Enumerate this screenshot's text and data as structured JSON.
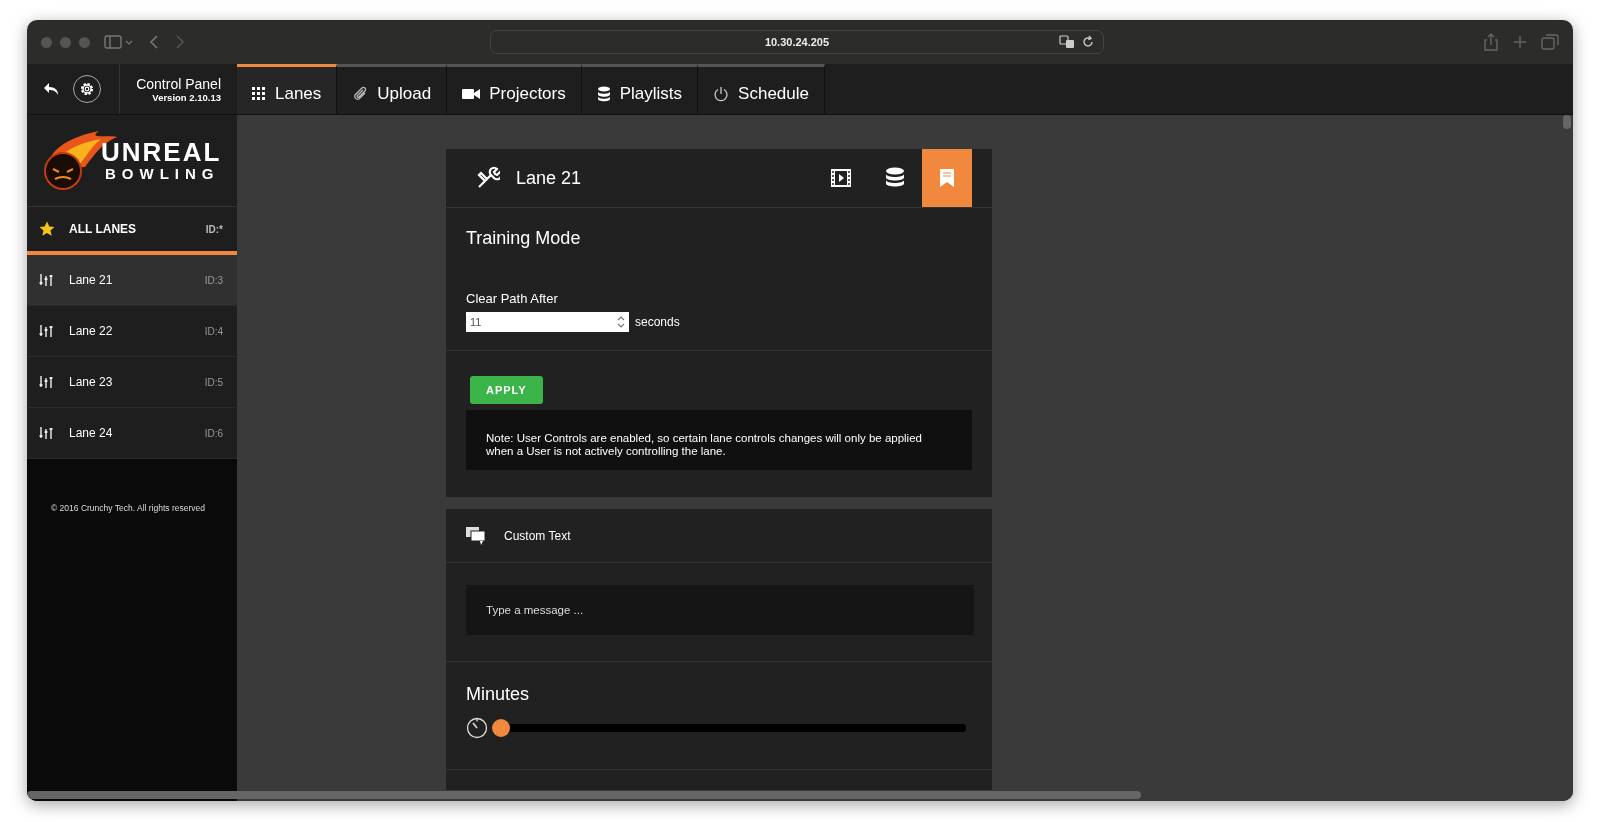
{
  "browser": {
    "url": "10.30.24.205"
  },
  "header": {
    "title": "Control Panel",
    "version": "Version 2.10.13"
  },
  "nav_tabs": [
    {
      "label": "Lanes",
      "kind": "grid",
      "selected": true
    },
    {
      "label": "Upload",
      "kind": "clip",
      "selected": false
    },
    {
      "label": "Projectors",
      "kind": "camera",
      "selected": false
    },
    {
      "label": "Playlists",
      "kind": "database",
      "selected": false
    },
    {
      "label": "Schedule",
      "kind": "power",
      "selected": false
    }
  ],
  "sidebar": {
    "logo": {
      "line_1": "UNREAL",
      "line_2": "BOWLING"
    },
    "all_lanes": {
      "label": "ALL LANES",
      "id": "ID:*"
    },
    "lanes": [
      {
        "name": "Lane 21",
        "id": "ID:3",
        "selected": true
      },
      {
        "name": "Lane 22",
        "id": "ID:4",
        "selected": false
      },
      {
        "name": "Lane 23",
        "id": "ID:5",
        "selected": false
      },
      {
        "name": "Lane 24",
        "id": "ID:6",
        "selected": false
      }
    ],
    "footer": "© 2016 Crunchy Tech. All rights reserved"
  },
  "panel": {
    "title": "Lane 21",
    "view_buttons": [
      {
        "kind": "film",
        "selected": false
      },
      {
        "kind": "database",
        "selected": false
      },
      {
        "kind": "bookmark",
        "selected": true
      }
    ],
    "section_title": "Training Mode",
    "field_label": "Clear Path After",
    "field_value": "11",
    "field_unit": "seconds",
    "apply_button": "APPLY",
    "note": "Note: User Controls are enabled, so certain lane controls changes will only be applied when a User is not actively controlling the lane."
  },
  "custom_text": {
    "title": "Custom Text",
    "placeholder": "Type a message ..."
  },
  "minutes": {
    "title": "Minutes",
    "level": 0
  }
}
